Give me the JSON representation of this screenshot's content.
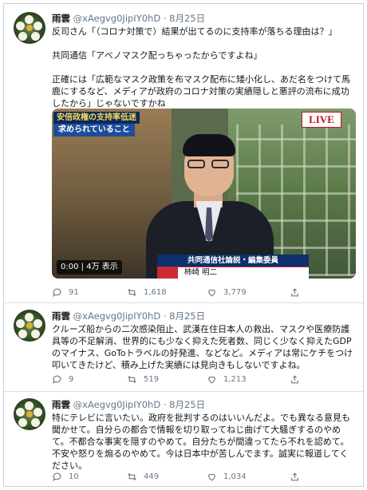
{
  "tweets": [
    {
      "name": "雨雲",
      "handle": "@xAegvg0JipIY0hD",
      "date": "· 8月25日",
      "body": [
        "反司さん「（コロナ対策で）結果が出てるのに支持率が落ちる理由は？」",
        "",
        "共同通信「アベノマスク配っちゃったからですよね」",
        "",
        "正確には「広範なマスク政策を布マスク配布に矮小化し、あだ名をつけて馬鹿にするなど、メディアが政府のコロナ対策の実績隠しと悪評の流布に成功したから」じゃないですかね"
      ],
      "replies": "91",
      "retweets": "1,618",
      "likes": "3,779"
    },
    {
      "name": "雨雲",
      "handle": "@xAegvg0JipIY0hD",
      "date": "· 8月25日",
      "body": [
        "クルーズ船からの二次感染阻止、武漢在住日本人の救出、マスクや医療防護具等の不足解消、世界的にも少なく抑えた死者数、同じく少なく抑えたGDPのマイナス、GoToトラベルの好発進、などなど。メディアは常にケチをつけ叩いてきたけど、積み上げた実績には見向きもしないですよね。"
      ],
      "replies": "9",
      "retweets": "519",
      "likes": "1,213"
    },
    {
      "name": "雨雲",
      "handle": "@xAegvg0JipIY0hD",
      "date": "· 8月25日",
      "body": [
        "特にテレビに言いたい。政府を批判するのはいいんだよ。でも異なる意見も聞かせて。自分らの都合で情報を切り取ってねじ曲げて大騒ぎするのやめて。不都合な事実を隠すのやめて。自分たちが間違ってたら不れを認めて。不安や怒りを煽るのやめて。今は日本中が苦しんでます。誠実に報道してください。"
      ],
      "replies": "10",
      "retweets": "449",
      "likes": "1,034"
    }
  ],
  "video": {
    "caption_top": "安倍政権の支持率低迷",
    "caption_sub": "求められていること",
    "live": "LIVE",
    "nameplate_title": "共同通信社論説・編集委員",
    "nameplate_name": "柿崎 明二",
    "duration": "0:00",
    "views": "4万 表示"
  },
  "colors": {
    "meta_gray": "#657786",
    "like_red": "#e0245e"
  }
}
